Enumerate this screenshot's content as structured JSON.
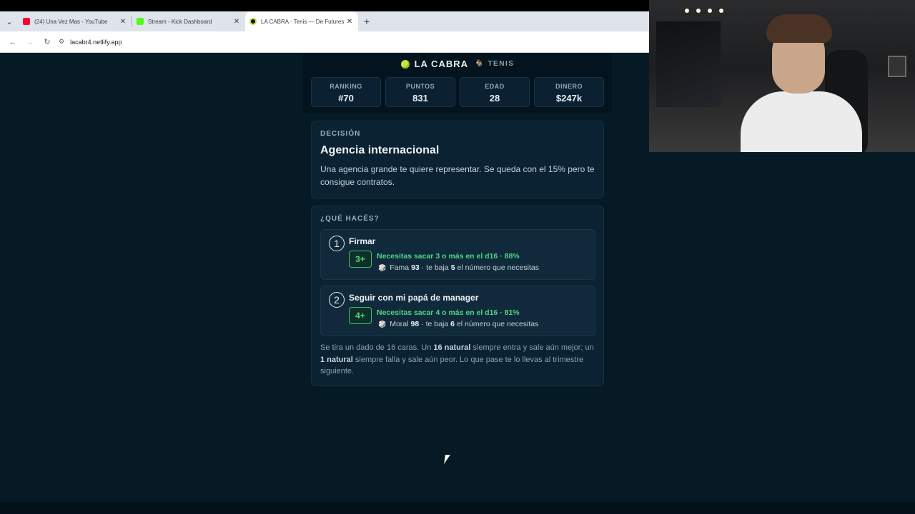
{
  "browser": {
    "tabs": [
      {
        "title": "(24) Una Vez Mas - YouTube",
        "favicon_color": "#ff0033",
        "active": false
      },
      {
        "title": "Stream - Kick Dashboard",
        "favicon_color": "#53fc18",
        "active": false
      },
      {
        "title": "LA CABRA · Tenis — De Futures",
        "favicon_color": "#111111",
        "active": true
      }
    ],
    "url": "lacabr4.netlify.app",
    "icons": {
      "back": "back-arrow-icon",
      "forward": "forward-arrow-icon",
      "reload": "reload-icon",
      "new_tab": "plus-icon",
      "site": "site-settings-icon"
    }
  },
  "game": {
    "brand": "LA CABRA",
    "subtitle": "TENIS",
    "stats": [
      {
        "label": "RANKING",
        "value": "#70"
      },
      {
        "label": "PUNTOS",
        "value": "831"
      },
      {
        "label": "EDAD",
        "value": "28"
      },
      {
        "label": "DINERO",
        "value": "$247k"
      }
    ],
    "decision": {
      "kicker": "DECISIÓN",
      "title": "Agencia internacional",
      "text": "Una agencia grande te quiere representar. Se queda con el 15% pero te consigue contratos."
    },
    "choices": {
      "kicker": "¿QUÉ HACÉS?",
      "options": [
        {
          "number": "1",
          "title": "Firmar",
          "badge": "3+",
          "chance": "Necesitas sacar 3 o más en el d16 · 88%",
          "mod_stat": "Fama",
          "mod_value": "93",
          "mod_mid": "· te baja",
          "mod_amount": "5",
          "mod_tail": "el número que necesitas"
        },
        {
          "number": "2",
          "title": "Seguir con mi papá de manager",
          "badge": "4+",
          "chance": "Necesitas sacar 4 o más en el d16 · 81%",
          "mod_stat": "Moral",
          "mod_value": "98",
          "mod_mid": "· te baja",
          "mod_amount": "6",
          "mod_tail": "el número que necesitas"
        }
      ],
      "footnote": {
        "p1": "Se tira un dado de 16 caras. Un ",
        "b1": "16 natural",
        "p2": " siempre entra y sale aún mejor; un ",
        "b2": "1 natural",
        "p3": " siempre falla y sale aún peor. Lo que pase te lo llevas al trimestre siguiente."
      }
    }
  },
  "colors": {
    "background": "#061a26",
    "accent_green": "#4fd685",
    "panel": "#0a2231"
  }
}
